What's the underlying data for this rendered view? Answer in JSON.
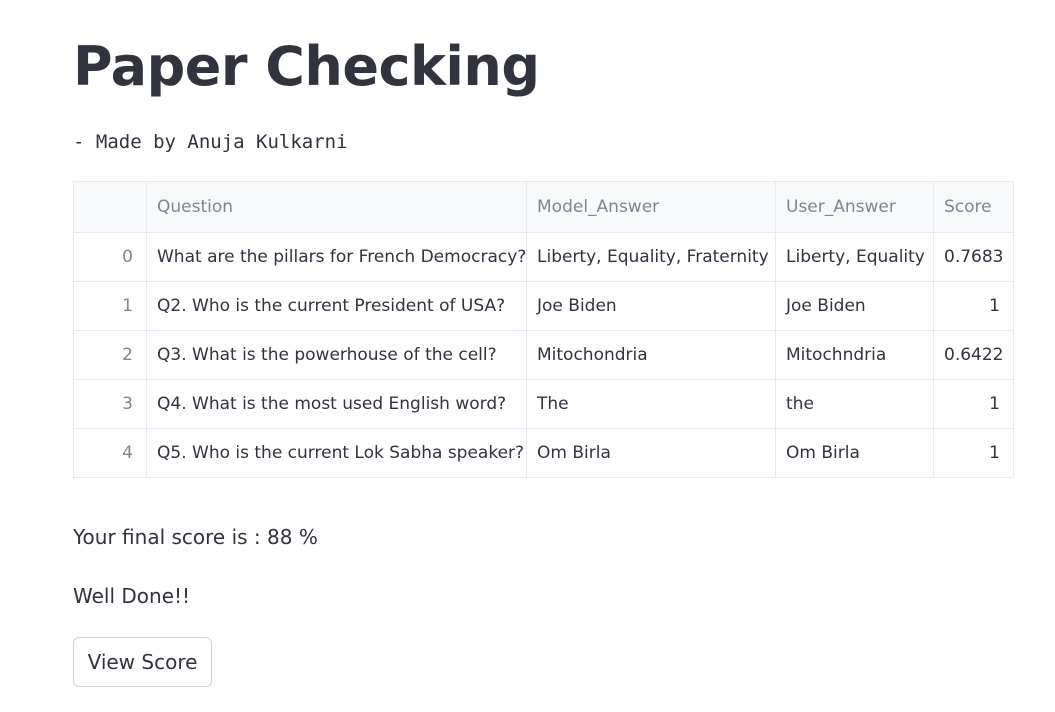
{
  "title": "Paper Checking",
  "subtitle": "- Made by Anuja Kulkarni",
  "table": {
    "columns": [
      "",
      "Question",
      "Model_Answer",
      "User_Answer",
      "Score"
    ],
    "rows": [
      {
        "index": "0",
        "question": "What are the pillars for French Democracy?",
        "model_answer": "Liberty, Equality, Fraternity",
        "user_answer": "Liberty, Equality",
        "score": "0.7683"
      },
      {
        "index": "1",
        "question": "Q2. Who is the current President of USA?",
        "model_answer": "Joe Biden",
        "user_answer": "Joe Biden",
        "score": "1"
      },
      {
        "index": "2",
        "question": "Q3. What is the powerhouse of the cell?",
        "model_answer": "Mitochondria",
        "user_answer": "Mitochndria",
        "score": "0.6422"
      },
      {
        "index": "3",
        "question": "Q4. What is the most used English word?",
        "model_answer": "The",
        "user_answer": "the",
        "score": "1"
      },
      {
        "index": "4",
        "question": "Q5. Who is the current Lok Sabha speaker?",
        "model_answer": "Om Birla",
        "user_answer": "Om Birla",
        "score": "1"
      }
    ]
  },
  "result": {
    "final_score_text": "Your final score is : 88 %",
    "message": "Well Done!!"
  },
  "buttons": {
    "view_score": "View Score"
  },
  "colors": {
    "text": "#31333f",
    "muted": "#808495",
    "border": "#e6e9ef",
    "header_bg": "#f8f9fb"
  }
}
